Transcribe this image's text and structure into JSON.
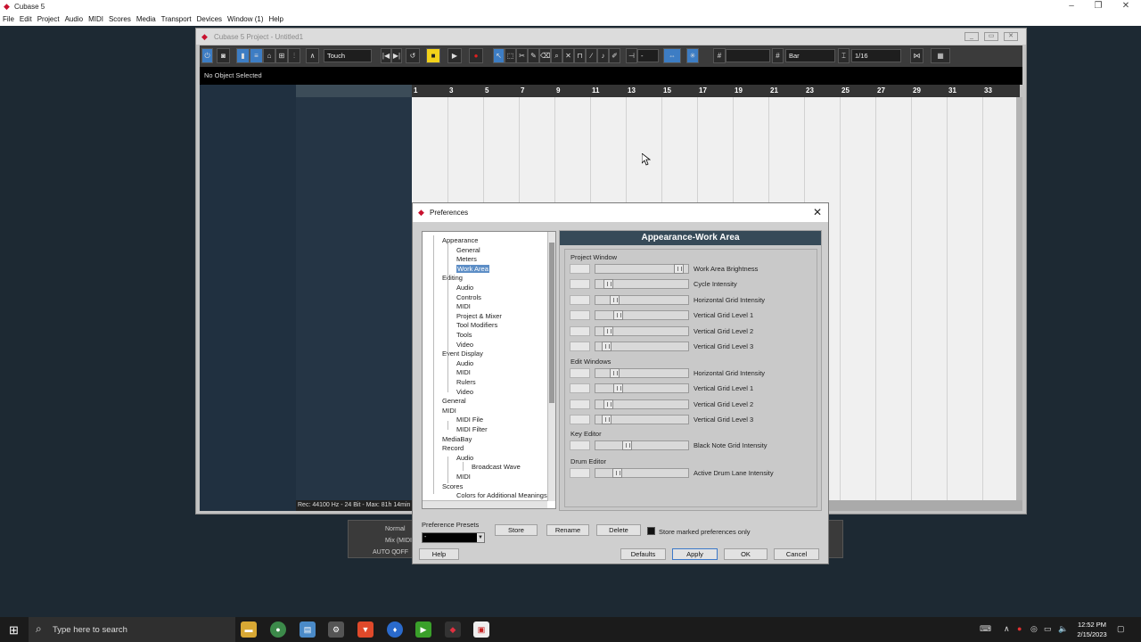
{
  "app": {
    "title": "Cubase 5"
  },
  "menu": [
    "File",
    "Edit",
    "Project",
    "Audio",
    "MIDI",
    "Scores",
    "Media",
    "Transport",
    "Devices",
    "Window (1)",
    "Help"
  ],
  "project_window": {
    "title": "Cubase 5 Project - Untitled1",
    "automation_mode": "Touch",
    "quantize_type": "Bar",
    "quantize_value": "1/16",
    "nudge_value": "-",
    "info_line": "No Object Selected",
    "status_line": "Rec: 44100 Hz - 24 Bit - Max: 81h 14min",
    "ruler_labels": [
      "1",
      "3",
      "5",
      "7",
      "9",
      "11",
      "13",
      "15",
      "17",
      "19",
      "21",
      "23",
      "25",
      "27",
      "29",
      "31",
      "33"
    ]
  },
  "transport": {
    "normal_label": "Normal",
    "mix_label": "Mix (MIDI)",
    "auto_label": "AUTO Q",
    "off_label": "OFF"
  },
  "preferences": {
    "title": "Preferences",
    "panel_header": "Appearance-Work Area",
    "tree": [
      {
        "label": "Appearance",
        "level": 0
      },
      {
        "label": "General",
        "level": 1
      },
      {
        "label": "Meters",
        "level": 1
      },
      {
        "label": "Work Area",
        "level": 1,
        "selected": true
      },
      {
        "label": "Editing",
        "level": 0
      },
      {
        "label": "Audio",
        "level": 1
      },
      {
        "label": "Controls",
        "level": 1
      },
      {
        "label": "MIDI",
        "level": 1
      },
      {
        "label": "Project & Mixer",
        "level": 1
      },
      {
        "label": "Tool Modifiers",
        "level": 1
      },
      {
        "label": "Tools",
        "level": 1
      },
      {
        "label": "Video",
        "level": 1
      },
      {
        "label": "Event Display",
        "level": 0
      },
      {
        "label": "Audio",
        "level": 1
      },
      {
        "label": "MIDI",
        "level": 1
      },
      {
        "label": "Rulers",
        "level": 1
      },
      {
        "label": "Video",
        "level": 1
      },
      {
        "label": "General",
        "level": 0
      },
      {
        "label": "MIDI",
        "level": 0
      },
      {
        "label": "MIDI File",
        "level": 1
      },
      {
        "label": "MIDI Filter",
        "level": 1
      },
      {
        "label": "MediaBay",
        "level": 0
      },
      {
        "label": "Record",
        "level": 0
      },
      {
        "label": "Audio",
        "level": 1
      },
      {
        "label": "Broadcast Wave",
        "level": 2
      },
      {
        "label": "MIDI",
        "level": 1
      },
      {
        "label": "Scores",
        "level": 0
      },
      {
        "label": "Colors for Additional Meanings",
        "level": 1
      }
    ],
    "sections": [
      {
        "title": "Project Window",
        "rows": [
          {
            "label": "Work Area Brightness",
            "value": 0.95
          },
          {
            "label": "Cycle Intensity",
            "value": 0.1
          },
          {
            "label": "Horizontal Grid Intensity",
            "value": 0.17
          },
          {
            "label": "Vertical Grid Level 1",
            "value": 0.22
          },
          {
            "label": "Vertical Grid Level 2",
            "value": 0.1
          },
          {
            "label": "Vertical Grid Level 3",
            "value": 0.07
          }
        ]
      },
      {
        "title": "Edit Windows",
        "rows": [
          {
            "label": "Horizontal Grid Intensity",
            "value": 0.17
          },
          {
            "label": "Vertical Grid Level 1",
            "value": 0.22
          },
          {
            "label": "Vertical Grid Level 2",
            "value": 0.1
          },
          {
            "label": "Vertical Grid Level 3",
            "value": 0.07
          }
        ]
      },
      {
        "title": "Key Editor",
        "rows": [
          {
            "label": "Black Note Grid Intensity",
            "value": 0.32
          }
        ]
      },
      {
        "title": "Drum Editor",
        "rows": [
          {
            "label": "Active Drum Lane Intensity",
            "value": 0.2
          }
        ]
      }
    ],
    "preset_label": "Preference Presets",
    "preset_value": "-",
    "store_label": "Store",
    "rename_label": "Rename",
    "delete_label": "Delete",
    "store_marked_label": "Store marked preferences only",
    "help_label": "Help",
    "defaults_label": "Defaults",
    "apply_label": "Apply",
    "ok_label": "OK",
    "cancel_label": "Cancel"
  },
  "taskbar": {
    "search_placeholder": "Type here to search",
    "time": "12:52 PM",
    "date": "2/15/2023"
  },
  "colors": {
    "accent": "#3d7dc4",
    "header": "#364a58",
    "brand": "#c8102e"
  }
}
